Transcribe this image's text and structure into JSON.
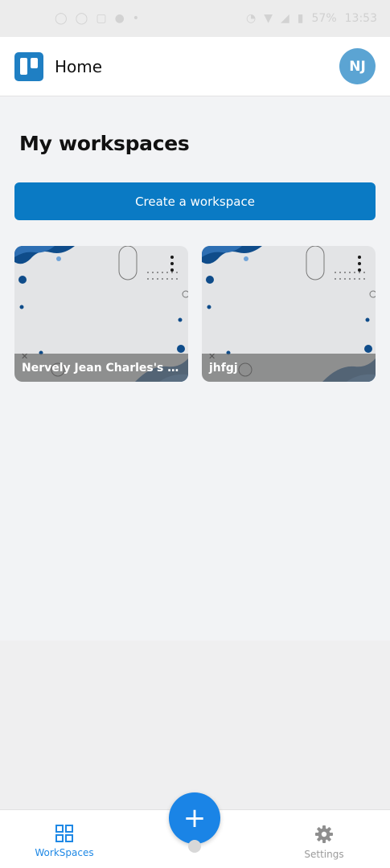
{
  "status_bar": {
    "left_icons": [
      "whatsapp-icon",
      "whatsapp-icon",
      "image-icon",
      "person-icon",
      "dot-icon"
    ],
    "right_icons": [
      "alarm-icon",
      "wifi-icon",
      "signal-icon",
      "battery-icon"
    ],
    "battery": "57%",
    "time": "13:53"
  },
  "app_bar": {
    "title": "Home",
    "avatar_initials": "NJ"
  },
  "main": {
    "heading": "My workspaces",
    "create_button": "Create a workspace",
    "workspaces": [
      {
        "name": "Nervely Jean Charles's w..."
      },
      {
        "name": "jhfgj"
      }
    ]
  },
  "bottom_nav": {
    "workspaces_label": "WorkSpaces",
    "settings_label": "Settings",
    "fab_symbol": "+"
  },
  "colors": {
    "accent": "#0a7ac4",
    "fab": "#1a84e6",
    "avatar": "#5ba4d3",
    "nav_active": "#1e88e5"
  }
}
